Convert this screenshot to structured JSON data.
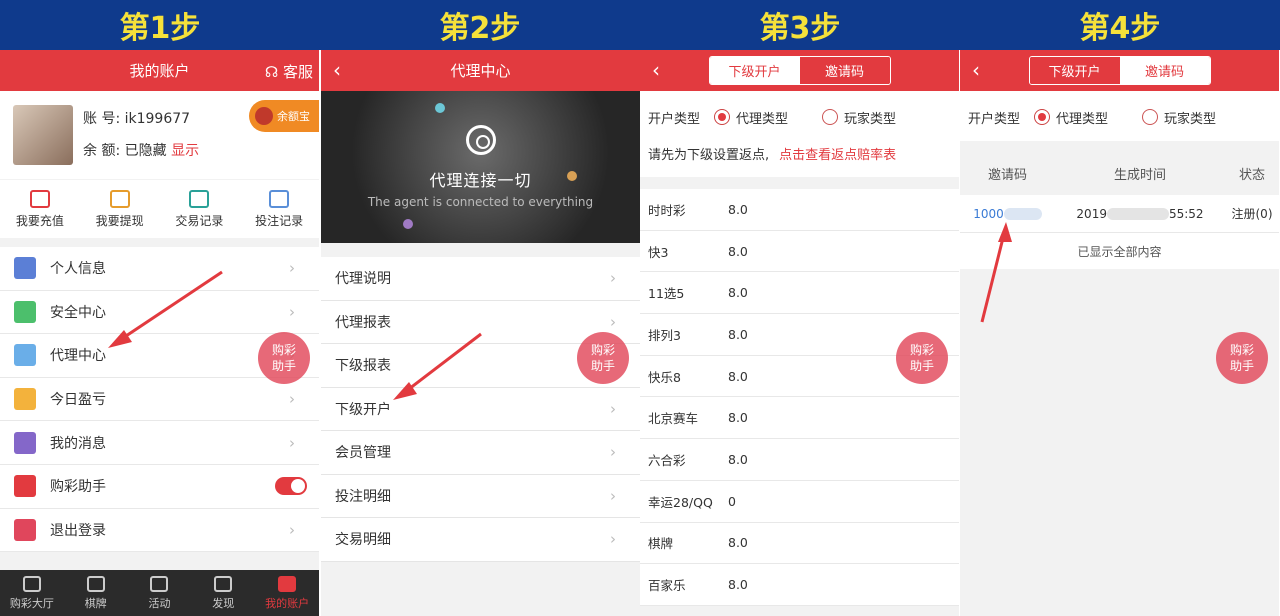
{
  "steps": [
    "第1步",
    "第2步",
    "第3步",
    "第4步"
  ],
  "panel1": {
    "title": "我的账户",
    "service": "客服",
    "account_label": "账 号:",
    "account_value": "ik199677",
    "balance_label": "余 额:",
    "balance_value": "已隐藏",
    "balance_show": "显示",
    "yue_bao": "余额宝",
    "quick_actions": [
      "我要充值",
      "我要提现",
      "交易记录",
      "投注记录"
    ],
    "menu": [
      "个人信息",
      "安全中心",
      "代理中心",
      "今日盈亏",
      "我的消息",
      "购彩助手",
      "退出登录"
    ],
    "tabs": [
      "购彩大厅",
      "棋牌",
      "活动",
      "发现",
      "我的账户"
    ],
    "colors": {
      "accent": "#e23a3f",
      "header": "#0f3a8c"
    }
  },
  "helper_line1": "购彩",
  "helper_line2": "助手",
  "panel2": {
    "title": "代理中心",
    "banner_title": "代理连接一切",
    "banner_subtitle": "The agent is connected to everything",
    "menu": [
      "代理说明",
      "代理报表",
      "下级报表",
      "下级开户",
      "会员管理",
      "投注明细",
      "交易明细"
    ]
  },
  "panel3": {
    "seg_left": "下级开户",
    "seg_right": "邀请码",
    "type_label": "开户类型",
    "option_agent": "代理类型",
    "option_player": "玩家类型",
    "hint": "请先为下级设置返点,",
    "hint_link": "点击查看返点赔率表",
    "rebates": [
      {
        "name": "时时彩",
        "value": "8.0"
      },
      {
        "name": "快3",
        "value": "8.0"
      },
      {
        "name": "11选5",
        "value": "8.0"
      },
      {
        "name": "排列3",
        "value": "8.0"
      },
      {
        "name": "快乐8",
        "value": "8.0"
      },
      {
        "name": "北京赛车",
        "value": "8.0"
      },
      {
        "name": "六合彩",
        "value": "8.0"
      },
      {
        "name": "幸运28/QQ",
        "value": "0"
      },
      {
        "name": "棋牌",
        "value": "8.0"
      },
      {
        "name": "百家乐",
        "value": "8.0"
      }
    ]
  },
  "panel4": {
    "seg_left": "下级开户",
    "seg_right": "邀请码",
    "type_label": "开户类型",
    "option_agent": "代理类型",
    "option_player": "玩家类型",
    "columns": [
      "邀请码",
      "生成时间",
      "状态"
    ],
    "row": {
      "code": "1000",
      "time_start": "2019",
      "time_end": "55:52",
      "status": "注册(0)"
    },
    "all_shown": "已显示全部内容"
  }
}
